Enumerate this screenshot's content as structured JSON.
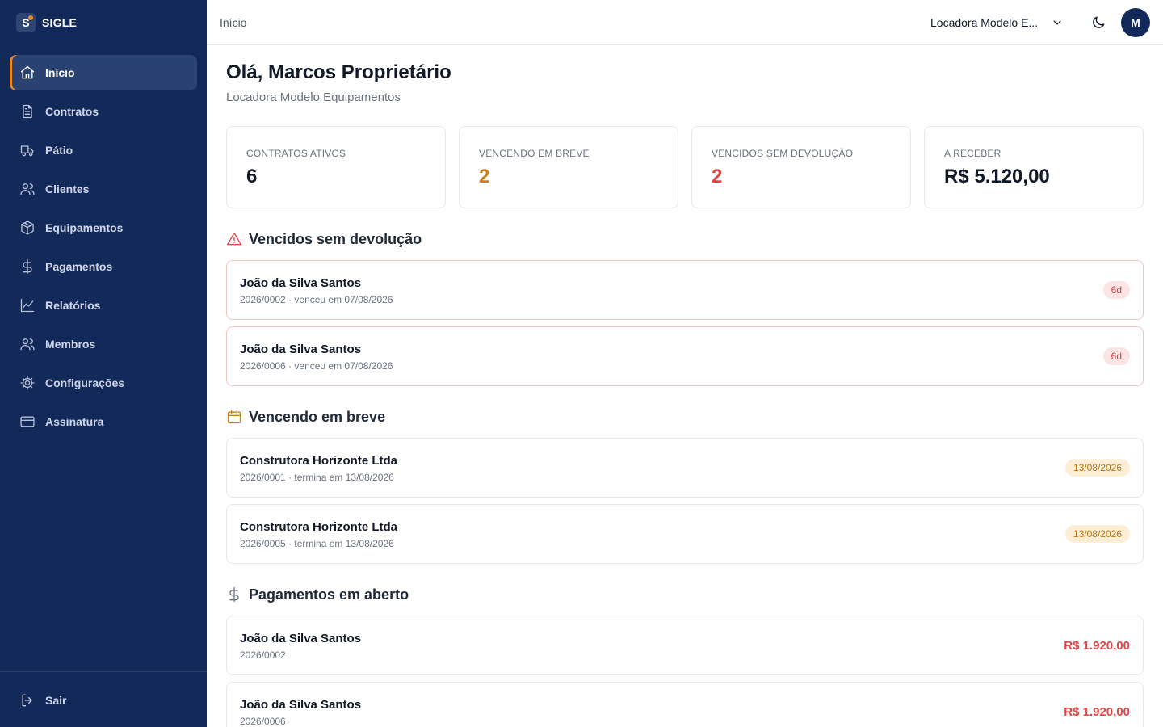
{
  "brand": {
    "logo_letter": "S",
    "name": "SIGLE"
  },
  "sidebar": {
    "items": [
      {
        "label": "Início",
        "icon": "home-icon",
        "active": true
      },
      {
        "label": "Contratos",
        "icon": "file-text-icon"
      },
      {
        "label": "Pátio",
        "icon": "truck-icon"
      },
      {
        "label": "Clientes",
        "icon": "users-icon"
      },
      {
        "label": "Equipamentos",
        "icon": "box-icon"
      },
      {
        "label": "Pagamentos",
        "icon": "dollar-icon"
      },
      {
        "label": "Relatórios",
        "icon": "chart-line-icon"
      },
      {
        "label": "Membros",
        "icon": "users-icon"
      },
      {
        "label": "Configurações",
        "icon": "gear-icon"
      },
      {
        "label": "Assinatura",
        "icon": "credit-card-icon"
      }
    ],
    "logout_label": "Sair"
  },
  "header": {
    "breadcrumb": "Início",
    "company": "Locadora Modelo E...",
    "avatar_initial": "M"
  },
  "main": {
    "greeting": "Olá, Marcos Proprietário",
    "company_name": "Locadora Modelo Equipamentos",
    "stats": [
      {
        "label": "CONTRATOS ATIVOS",
        "value": "6"
      },
      {
        "label": "VENCENDO EM BREVE",
        "value": "2"
      },
      {
        "label": "VENCIDOS SEM DEVOLUÇÃO",
        "value": "2"
      },
      {
        "label": "A RECEBER",
        "value": "R$ 5.120,00"
      }
    ],
    "overdue": {
      "title": "Vencidos sem devolução",
      "items": [
        {
          "name": "João da Silva Santos",
          "detail": "2026/0002 · venceu em 07/08/2026",
          "badge": "6d"
        },
        {
          "name": "João da Silva Santos",
          "detail": "2026/0006 · venceu em 07/08/2026",
          "badge": "6d"
        }
      ]
    },
    "expiring": {
      "title": "Vencendo em breve",
      "items": [
        {
          "name": "Construtora Horizonte Ltda",
          "detail": "2026/0001 · termina em 13/08/2026",
          "badge": "13/08/2026"
        },
        {
          "name": "Construtora Horizonte Ltda",
          "detail": "2026/0005 · termina em 13/08/2026",
          "badge": "13/08/2026"
        }
      ]
    },
    "payments": {
      "title": "Pagamentos em aberto",
      "items": [
        {
          "name": "João da Silva Santos",
          "detail": "2026/0002",
          "amount": "R$ 1.920,00"
        },
        {
          "name": "João da Silva Santos",
          "detail": "2026/0006",
          "amount": "R$ 1.920,00"
        }
      ]
    }
  },
  "colors": {
    "sidebar_bg": "#13295a",
    "accent": "#f08a24",
    "warning": "#c9821a",
    "danger": "#e04646"
  }
}
